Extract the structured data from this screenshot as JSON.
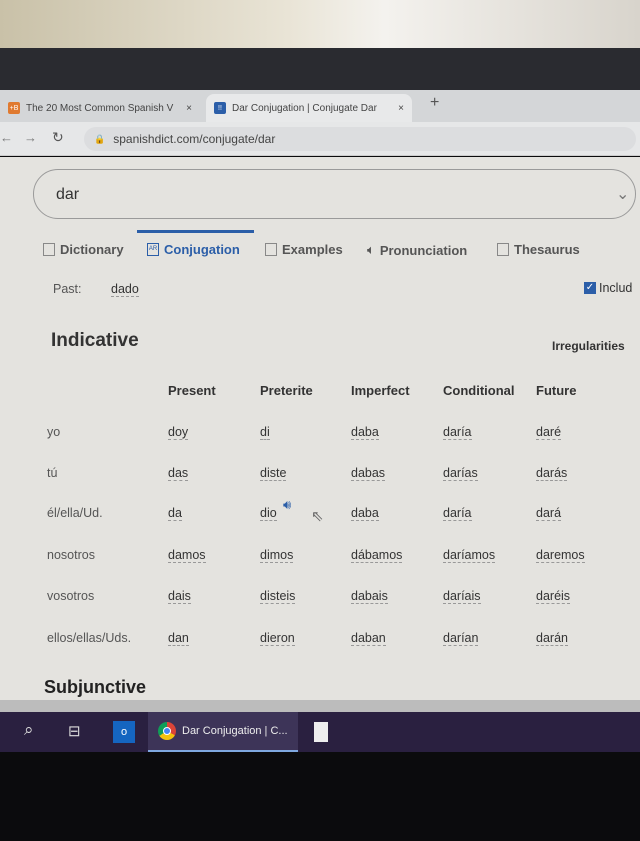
{
  "browser": {
    "tabs": [
      {
        "title": "The 20 Most Common Spanish V",
        "favicon": "+B",
        "active": false
      },
      {
        "title": "Dar Conjugation | Conjugate Dar",
        "favicon": "!!",
        "active": true
      }
    ],
    "new_tab": "+",
    "close": "×",
    "url": "spanishdict.com/conjugate/dar"
  },
  "search": {
    "value": "dar"
  },
  "nav": [
    {
      "label": "Dictionary",
      "icon": "book-icon"
    },
    {
      "label": "Conjugation",
      "icon": "ar-icon",
      "active": true
    },
    {
      "label": "Examples",
      "icon": "chat-icon"
    },
    {
      "label": "Pronunciation",
      "icon": "speaker-icon"
    },
    {
      "label": "Thesaurus",
      "icon": "open-book-icon"
    }
  ],
  "past": {
    "label": "Past:",
    "value": "dado"
  },
  "include": {
    "label": "Includ",
    "checked": true
  },
  "indicative": {
    "title": "Indicative",
    "irregularities": "Irregularities",
    "columns": [
      "Present",
      "Preterite",
      "Imperfect",
      "Conditional",
      "Future"
    ],
    "rows": [
      {
        "pronoun": "yo",
        "forms": [
          "doy",
          "di",
          "daba",
          "daría",
          "daré"
        ]
      },
      {
        "pronoun": "tú",
        "forms": [
          "das",
          "diste",
          "dabas",
          "darías",
          "darás"
        ]
      },
      {
        "pronoun": "él/ella/Ud.",
        "forms": [
          "da",
          "dio",
          "daba",
          "daría",
          "dará"
        ]
      },
      {
        "pronoun": "nosotros",
        "forms": [
          "damos",
          "dimos",
          "dábamos",
          "daríamos",
          "daremos"
        ]
      },
      {
        "pronoun": "vosotros",
        "forms": [
          "dais",
          "disteis",
          "dabais",
          "daríais",
          "daréis"
        ]
      },
      {
        "pronoun": "ellos/ellas/Uds.",
        "forms": [
          "dan",
          "dieron",
          "daban",
          "darían",
          "darán"
        ]
      }
    ]
  },
  "subjunctive": {
    "title": "Subjunctive"
  },
  "taskbar": {
    "chrome_label": "Dar Conjugation | C...",
    "accent": "#7fa8e0"
  },
  "colors": {
    "accent": "#2b5ea8"
  }
}
